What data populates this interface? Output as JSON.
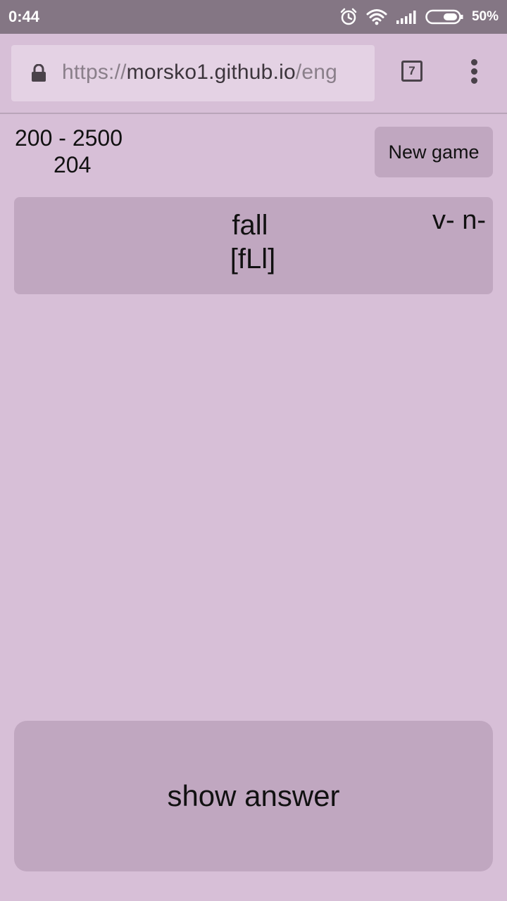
{
  "status_bar": {
    "time": "0:44",
    "battery": "50%",
    "icons": [
      "alarm-icon",
      "wifi-icon",
      "signal-icon",
      "battery-icon"
    ]
  },
  "browser": {
    "url_scheme": "https://",
    "url_host": "morsko1.github.io",
    "url_path": "/eng",
    "tab_count": "7",
    "colors": {
      "status_bar": "#847684",
      "toolbar": "#d7bfd7",
      "url_bar": "#e4d2e4"
    }
  },
  "game": {
    "range": "200 - 2500",
    "count": "204",
    "new_game_label": "New game",
    "word": "fall",
    "transcription": "[fLl]",
    "parts_of_speech": "v- n-",
    "show_answer_label": "show answer",
    "colors": {
      "background": "#d7bfd7",
      "card": "#c0a7c0",
      "text": "#111111"
    }
  }
}
